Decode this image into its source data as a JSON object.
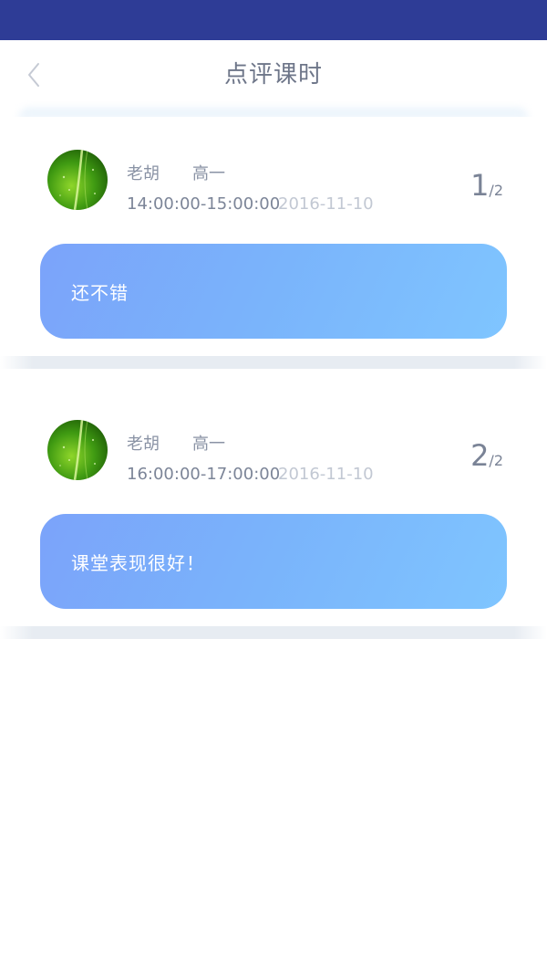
{
  "header": {
    "title": "点评课时",
    "back_icon": "chevron-left-icon"
  },
  "colors": {
    "status_bar": "#2e3c96",
    "bubble_start": "#7ba3fa",
    "bubble_end": "#7fc5ff",
    "text_muted": "#8a93a5",
    "date_text": "#c2c8d3"
  },
  "reviews": [
    {
      "teacher": "老胡",
      "grade": "高一",
      "time": "14:00:00-15:00:00",
      "date": "2016-11-10",
      "index": "1",
      "separator": "/",
      "total": "2",
      "comment": "还不错",
      "avatar": "leaf-avatar"
    },
    {
      "teacher": "老胡",
      "grade": "高一",
      "time": "16:00:00-17:00:00",
      "date": "2016-11-10",
      "index": "2",
      "separator": "/",
      "total": "2",
      "comment": "课堂表现很好！",
      "avatar": "leaf-avatar"
    }
  ]
}
